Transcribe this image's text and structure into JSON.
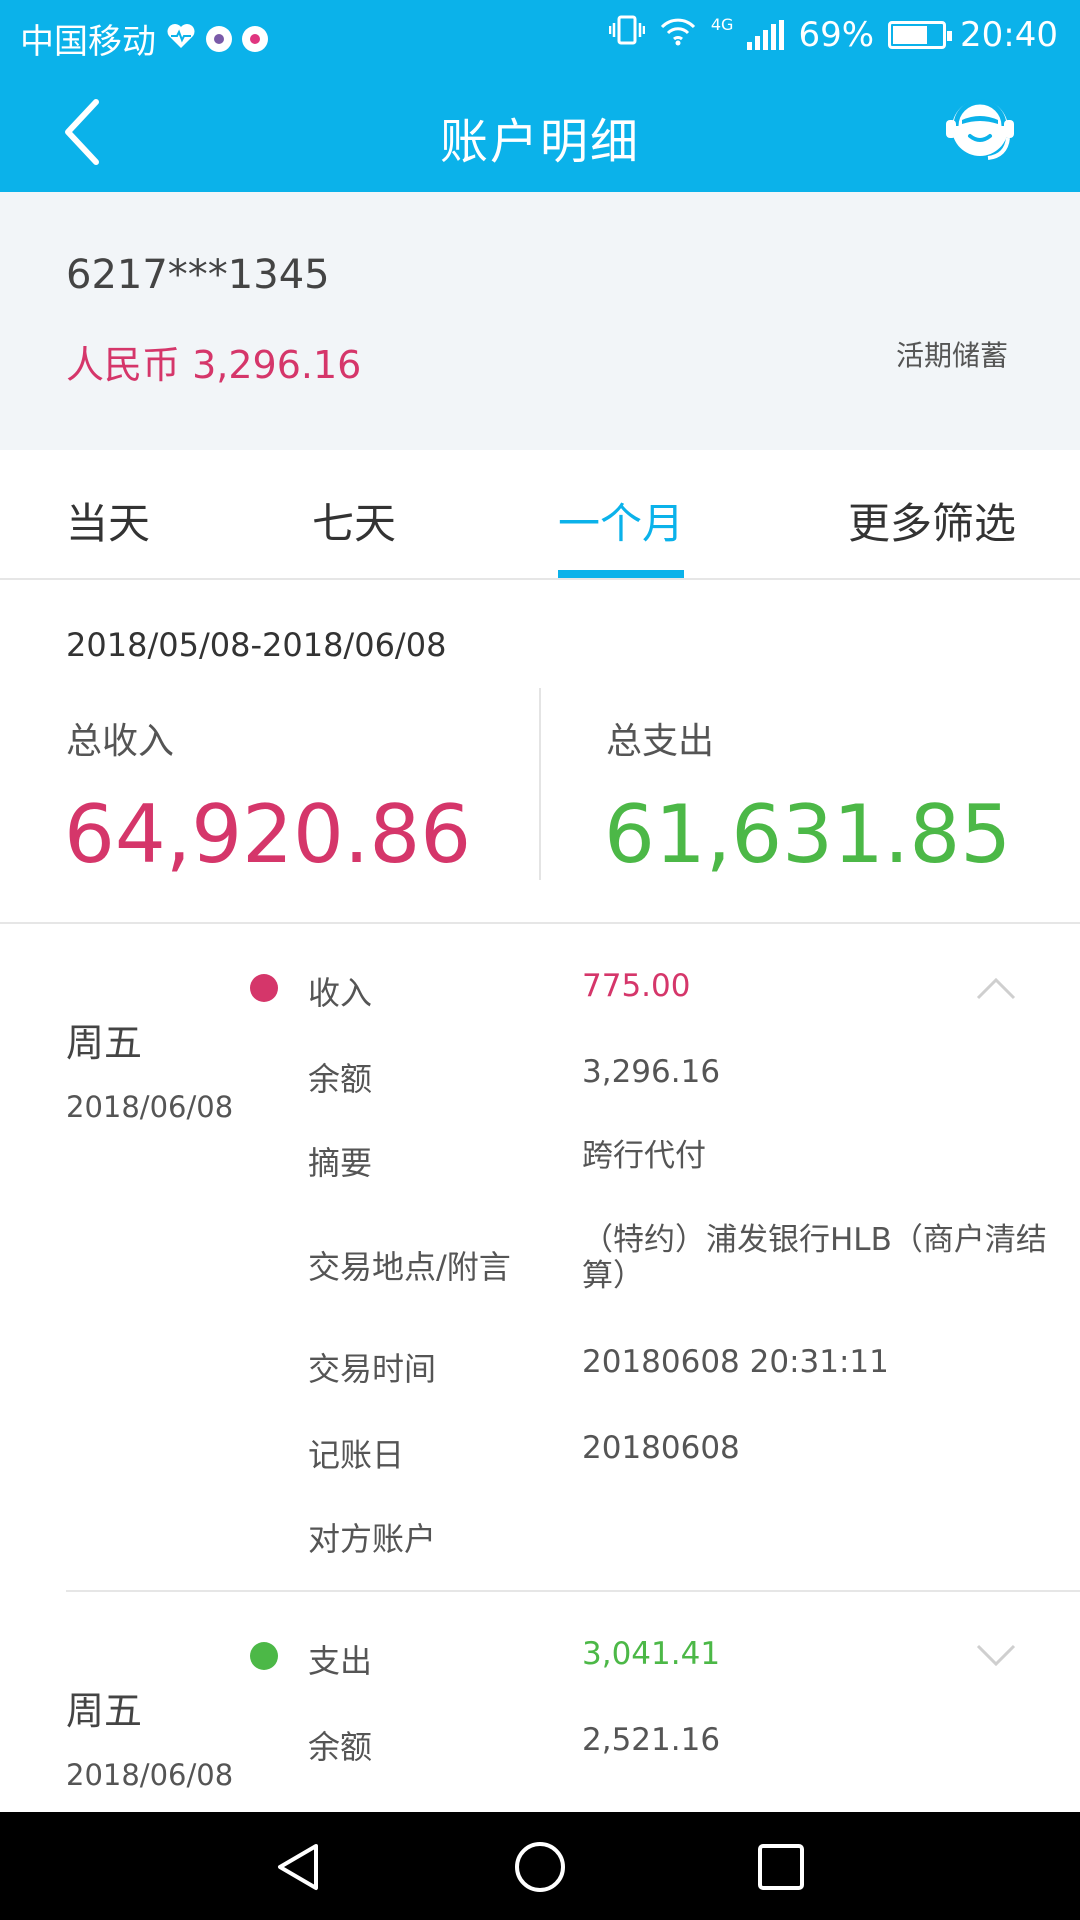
{
  "status_bar": {
    "carrier": "中国移动",
    "network": "4G",
    "battery": "69%",
    "time": "20:40"
  },
  "header": {
    "title": "账户明细"
  },
  "account": {
    "number": "6217***1345",
    "balance": "人民币 3,296.16",
    "type": "活期储蓄"
  },
  "tabs": [
    {
      "label": "当天",
      "active": false
    },
    {
      "label": "七天",
      "active": false
    },
    {
      "label": "一个月",
      "active": true
    },
    {
      "label": "更多筛选",
      "active": false
    }
  ],
  "summary": {
    "range": "2018/05/08-2018/06/08",
    "income_label": "总收入",
    "income_value": "64,920.86",
    "expense_label": "总支出",
    "expense_value": "61,631.85"
  },
  "transactions": [
    {
      "weekday": "周五",
      "date": "2018/06/08",
      "expanded": true,
      "rows": [
        {
          "key": "收入",
          "value": "775.00"
        },
        {
          "key": "余额",
          "value": "3,296.16"
        },
        {
          "key": "摘要",
          "value": "跨行代付"
        },
        {
          "key": "交易地点/附言",
          "value": "（特约）浦发银行HLB（商户清结算）"
        },
        {
          "key": "交易时间",
          "value": "20180608 20:31:11"
        },
        {
          "key": "记账日",
          "value": "20180608"
        },
        {
          "key": "对方账户",
          "value": ""
        }
      ]
    },
    {
      "weekday": "周五",
      "date": "2018/06/08",
      "expanded": false,
      "rows": [
        {
          "key": "支出",
          "value": "3,041.41"
        },
        {
          "key": "余额",
          "value": "2,521.16"
        }
      ]
    }
  ],
  "colors": {
    "brand": "#0bb2ea",
    "income": "#d5366a",
    "expense": "#4cb847"
  }
}
